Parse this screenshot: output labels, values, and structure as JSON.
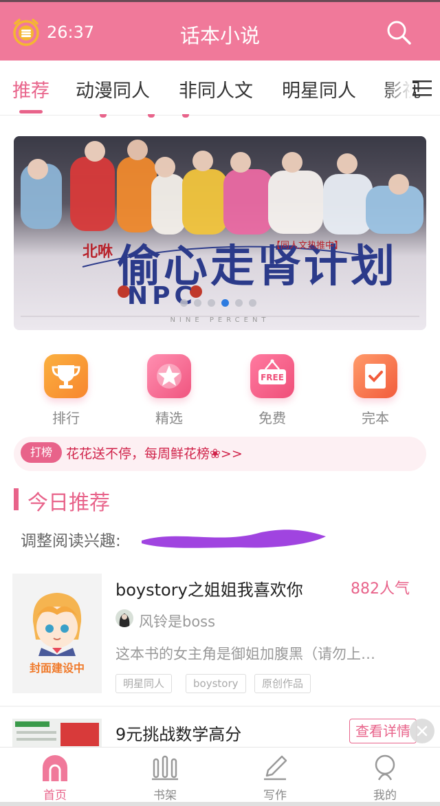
{
  "status": {
    "time": "26:37"
  },
  "header": {
    "title": "话本小说"
  },
  "tabs": [
    {
      "label": "推荐",
      "active": true
    },
    {
      "label": "动漫同人"
    },
    {
      "label": "非同人文"
    },
    {
      "label": "明星同人"
    },
    {
      "label": "影视"
    }
  ],
  "banner": {
    "author": "北咻",
    "title": "偷心走肾计划",
    "tag": "【同人文热推中】",
    "npc": "NPC",
    "footer": "NINE PERCENT",
    "active_dot": 3,
    "dot_count": 6
  },
  "quick_links": [
    {
      "label": "排行",
      "icon": "trophy-icon"
    },
    {
      "label": "精选",
      "icon": "star-icon"
    },
    {
      "label": "免费",
      "icon": "free-sign-icon"
    },
    {
      "label": "完本",
      "icon": "check-book-icon"
    }
  ],
  "promo": {
    "badge": "打榜",
    "text": "花花送不停，每周鲜花榜❀>>"
  },
  "section": {
    "title": "今日推荐",
    "interest_label": "调整阅读兴趣:"
  },
  "book": {
    "title": "boystory之姐姐我喜欢你",
    "popularity": "882人气",
    "author": "风铃是boss",
    "description": "这本书的女主角是御姐加腹黑（请勿上…",
    "cover_text": "封面建设中",
    "tags": [
      "明星同人",
      "boystory",
      "原创作品"
    ]
  },
  "ad": {
    "title": "9元挑战数学高分",
    "button": "查看详情"
  },
  "bottom_nav": [
    {
      "label": "首页",
      "icon": "home-icon",
      "active": true
    },
    {
      "label": "书架",
      "icon": "bookshelf-icon"
    },
    {
      "label": "写作",
      "icon": "pen-icon"
    },
    {
      "label": "我的",
      "icon": "profile-icon"
    }
  ],
  "colors": {
    "brand": "#f0799a",
    "accent": "#e8638a",
    "promo_text": "#d0234a"
  }
}
